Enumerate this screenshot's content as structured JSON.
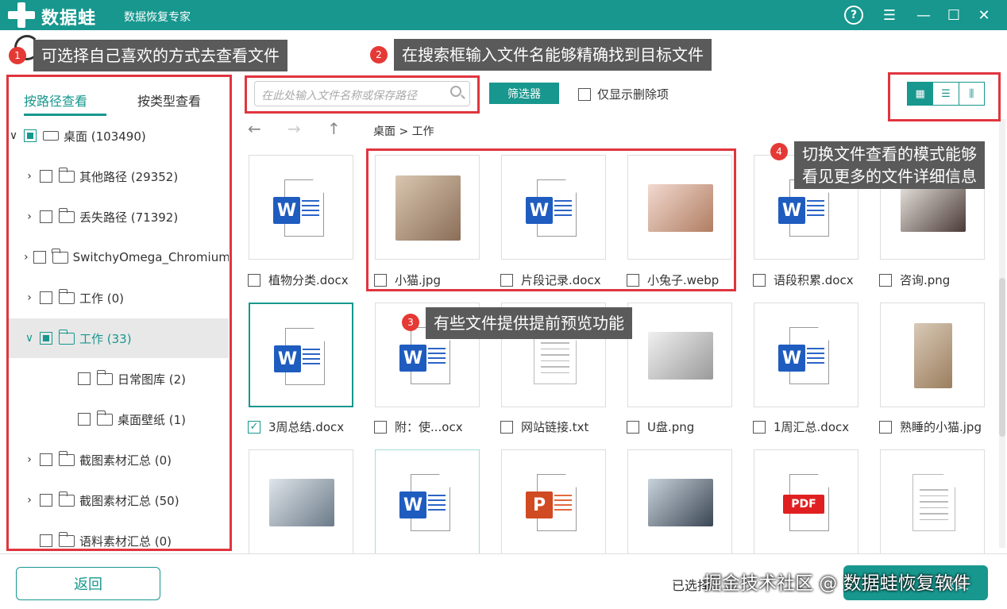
{
  "app": {
    "brand": "数据蛙",
    "subtitle": "数据恢复专家",
    "help_glyph": "?"
  },
  "callouts": [
    {
      "num": "1",
      "text": "可选择自己喜欢的方式去查看文件"
    },
    {
      "num": "2",
      "text": "在搜索框输入文件名能够精确找到目标文件"
    },
    {
      "num": "3",
      "text": "有些文件提供提前预览功能"
    },
    {
      "num": "4",
      "line1": "切换文件查看的模式能够",
      "line2": "看见更多的文件详细信息"
    }
  ],
  "tabs": [
    {
      "label": "按路径查看",
      "active": true
    },
    {
      "label": "按类型查看",
      "active": false
    }
  ],
  "tree": [
    {
      "label": "桌面 (103490)",
      "chev": "∨",
      "check": "partial",
      "icon": "drive-icon"
    },
    {
      "label": "其他路径 (29352)",
      "chev": "›",
      "check": "none",
      "icon": "folder-icon"
    },
    {
      "label": "丢失路径 (71392)",
      "chev": "›",
      "check": "none",
      "icon": "folder-icon"
    },
    {
      "label": "SwitchyOmega_Chromium",
      "chev": "›",
      "check": "none",
      "icon": "folder-icon"
    },
    {
      "label": "工作 (0)",
      "chev": "›",
      "check": "none",
      "icon": "folder-icon"
    },
    {
      "label": "工作 (33)",
      "chev": "∨",
      "check": "partial",
      "icon": "folder-icon",
      "selected": true
    },
    {
      "label": "日常图库 (2)",
      "chev": "",
      "check": "none",
      "icon": "folder-icon"
    },
    {
      "label": "桌面壁纸 (1)",
      "chev": "",
      "check": "none",
      "icon": "folder-icon"
    },
    {
      "label": "截图素材汇总 (0)",
      "chev": "›",
      "check": "none",
      "icon": "folder-icon"
    },
    {
      "label": "截图素材汇总 (50)",
      "chev": "›",
      "check": "none",
      "icon": "folder-icon"
    },
    {
      "label": "语料素材汇总 (0)",
      "chev": "",
      "check": "none",
      "icon": "folder-icon"
    }
  ],
  "toolbar": {
    "search_placeholder": "在此处输入文件名称或保存路径",
    "filter_label": "筛选器",
    "deleted_only_label": "仅显示删除项",
    "view_icons": [
      "grid-view-icon",
      "list-view-icon",
      "detail-view-icon"
    ]
  },
  "nav": {
    "back": "←",
    "forward": "→",
    "up": "↑",
    "breadcrumb": "桌面 > 工作"
  },
  "files": [
    {
      "name": "植物分类.docx",
      "type": "word",
      "checked": false
    },
    {
      "name": "小猫.jpg",
      "type": "image",
      "tone": [
        "#d9c6b0",
        "#8a6e58"
      ],
      "checked": false
    },
    {
      "name": "片段记录.docx",
      "type": "word",
      "checked": false
    },
    {
      "name": "小兔子.webp",
      "type": "image",
      "tone": [
        "#f2d9cf",
        "#b07d62"
      ],
      "checked": false
    },
    {
      "name": "语段积累.docx",
      "type": "word",
      "checked": false
    },
    {
      "name": "咨询.png",
      "type": "image",
      "tone": [
        "#e6e2dc",
        "#4a3a38"
      ],
      "checked": false
    },
    {
      "name": "3周总结.docx",
      "type": "word",
      "checked": true
    },
    {
      "name": "附：使...ocx",
      "type": "word",
      "checked": false
    },
    {
      "name": "网站链接.txt",
      "type": "txt",
      "checked": false
    },
    {
      "name": "U盘.png",
      "type": "image",
      "tone": [
        "#f0f0f0",
        "#9a9a9a"
      ],
      "checked": false
    },
    {
      "name": "1周汇总.docx",
      "type": "word",
      "checked": false
    },
    {
      "name": "熟睡的小猫.jpg",
      "type": "image",
      "tone": [
        "#d8c9b6",
        "#9c7e5e"
      ],
      "checked": false
    },
    {
      "name": "",
      "type": "image",
      "tone": [
        "#dfe5ea",
        "#6b7a88"
      ],
      "checked": false
    },
    {
      "name": "",
      "type": "word",
      "checked": false
    },
    {
      "name": "",
      "type": "ppt",
      "checked": false
    },
    {
      "name": "",
      "type": "image",
      "tone": [
        "#c9d3dc",
        "#3b4654"
      ],
      "checked": false
    },
    {
      "name": "",
      "type": "pdf",
      "checked": false
    },
    {
      "name": "",
      "type": "txt",
      "checked": false
    }
  ],
  "footer": {
    "back_label": "返回",
    "selected_info": "已选择",
    "recover_label": "恢复",
    "watermark": "掘金技术社区 @ 数据蛙恢复软件"
  },
  "colors": {
    "accent": "#17978e",
    "callout_bg": "#5a5a5a",
    "marker": "#e53935",
    "highlight_box": "#e0353f"
  }
}
